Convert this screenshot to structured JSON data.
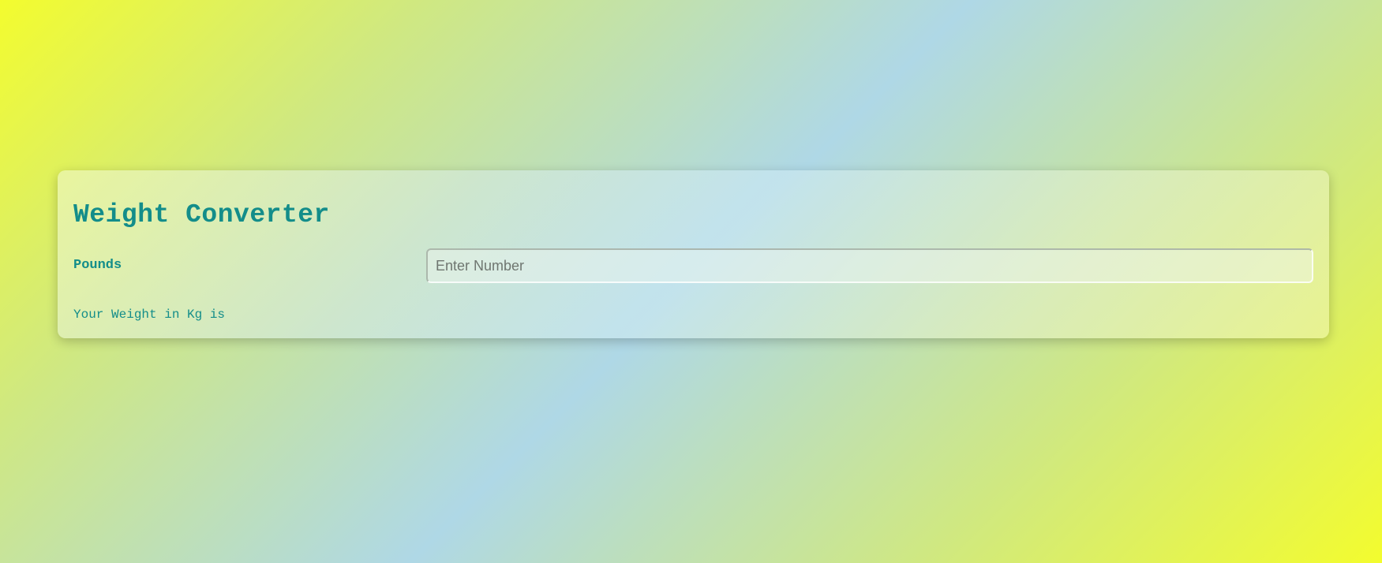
{
  "converter": {
    "title": "Weight Converter",
    "input_label": "Pounds",
    "input_placeholder": "Enter Number",
    "input_value": "",
    "result_text": "Your Weight in Kg is"
  },
  "colors": {
    "accent": "#138d8a",
    "gradient_yellow": "#f3fc2e",
    "gradient_blue": "#afd8e6"
  }
}
